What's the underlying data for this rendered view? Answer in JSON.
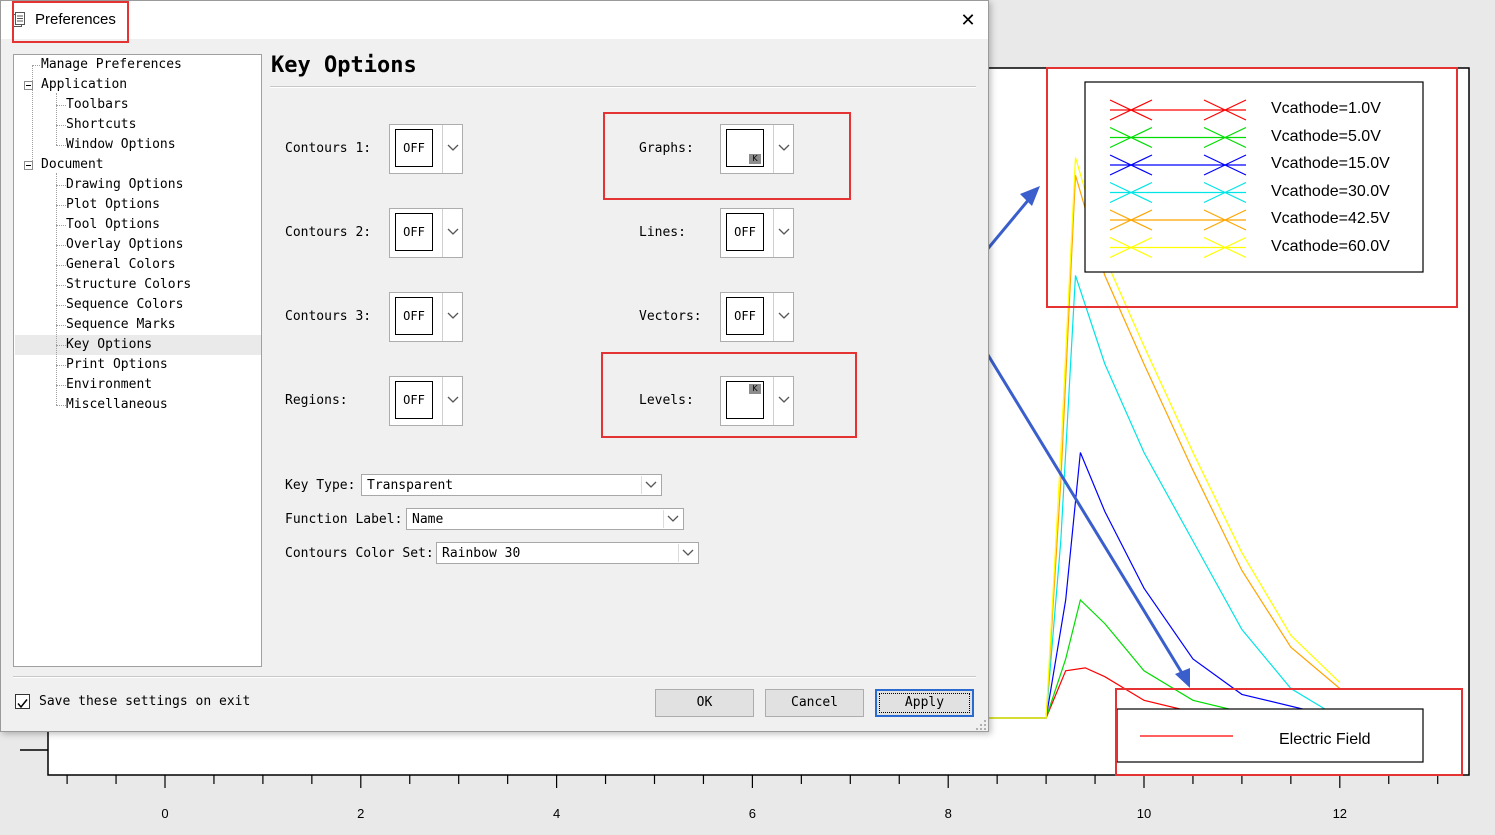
{
  "dialog": {
    "title": "Preferences",
    "close_glyph": "✕",
    "icon": "document-icon"
  },
  "tree": {
    "items": [
      {
        "label": "Manage Preferences"
      },
      {
        "label": "Application"
      },
      {
        "label": "Toolbars"
      },
      {
        "label": "Shortcuts"
      },
      {
        "label": "Window Options"
      },
      {
        "label": "Document"
      },
      {
        "label": "Drawing Options"
      },
      {
        "label": "Plot Options"
      },
      {
        "label": "Tool Options"
      },
      {
        "label": "Overlay Options"
      },
      {
        "label": "General Colors"
      },
      {
        "label": "Structure Colors"
      },
      {
        "label": "Sequence Colors"
      },
      {
        "label": "Sequence Marks"
      },
      {
        "label": "Key Options"
      },
      {
        "label": "Print Options"
      },
      {
        "label": "Environment"
      },
      {
        "label": "Miscellaneous"
      }
    ],
    "selected": "Key Options"
  },
  "section": {
    "title": "Key Options"
  },
  "keys": {
    "contours1": {
      "label": "Contours 1:",
      "value": "OFF"
    },
    "contours2": {
      "label": "Contours 2:",
      "value": "OFF"
    },
    "contours3": {
      "label": "Contours 3:",
      "value": "OFF"
    },
    "regions": {
      "label": "Regions:",
      "value": "OFF"
    },
    "graphs": {
      "label": "Graphs:",
      "value": "",
      "badge": "K",
      "badge_position": "bottom-right"
    },
    "lines": {
      "label": "Lines:",
      "value": "OFF"
    },
    "vectors": {
      "label": "Vectors:",
      "value": "OFF"
    },
    "levels": {
      "label": "Levels:",
      "value": "",
      "badge": "K",
      "badge_position": "top-right"
    }
  },
  "fields": {
    "key_type": {
      "label": "Key Type:",
      "value": "Transparent"
    },
    "function_label": {
      "label": "Function Label:",
      "value": "Name"
    },
    "contours_color_set": {
      "label": "Contours Color Set:",
      "value": "Rainbow 30"
    }
  },
  "footer": {
    "save_label": "Save these settings on exit",
    "save_checked": true,
    "ok": "OK",
    "cancel": "Cancel",
    "apply": "Apply"
  },
  "colors": {
    "highlight_box": "#e53333",
    "arrow": "#3a5fcd",
    "default_button_border": "#2a6bd1"
  },
  "chart_data": {
    "type": "line",
    "x_ticks": [
      "0",
      "2",
      "4",
      "6",
      "8",
      "10",
      "12"
    ],
    "xlim": [
      -2,
      13
    ],
    "series": [
      {
        "name": "Vcathode=1.0V",
        "color": "#ff0000",
        "x": [
          9.0,
          9.2,
          9.4,
          9.6,
          10.0,
          10.5,
          11,
          12
        ],
        "y": [
          0.0,
          0.08,
          0.085,
          0.07,
          0.03,
          0.01,
          0.0,
          0.0
        ]
      },
      {
        "name": "Vcathode=5.0V",
        "color": "#00dd00",
        "x": [
          9.0,
          9.2,
          9.35,
          9.6,
          10.0,
          10.5,
          11,
          12
        ],
        "y": [
          0.0,
          0.1,
          0.2,
          0.16,
          0.08,
          0.03,
          0.01,
          0.0
        ]
      },
      {
        "name": "Vcathode=15.0V",
        "color": "#0000ff",
        "x": [
          9.0,
          9.2,
          9.35,
          9.6,
          10.0,
          10.5,
          11,
          12
        ],
        "y": [
          0.0,
          0.2,
          0.45,
          0.35,
          0.22,
          0.1,
          0.04,
          0.0
        ]
      },
      {
        "name": "Vcathode=30.0V",
        "color": "#00e5e5",
        "x": [
          9.0,
          9.15,
          9.3,
          9.6,
          10.0,
          10.5,
          11,
          11.5,
          12
        ],
        "y": [
          0.0,
          0.3,
          0.75,
          0.6,
          0.45,
          0.3,
          0.15,
          0.05,
          0.0
        ]
      },
      {
        "name": "Vcathode=42.5V",
        "color": "#ffa500",
        "x": [
          9.0,
          9.15,
          9.3,
          9.6,
          10.0,
          10.5,
          11,
          11.5,
          12
        ],
        "y": [
          0.0,
          0.4,
          0.92,
          0.75,
          0.6,
          0.42,
          0.25,
          0.12,
          0.05
        ]
      },
      {
        "name": "Vcathode=60.0V",
        "color": "#ffff00",
        "x": [
          9.0,
          9.15,
          9.3,
          9.6,
          10.0,
          10.5,
          11,
          11.5,
          12
        ],
        "y": [
          0.0,
          0.45,
          0.95,
          0.78,
          0.63,
          0.45,
          0.28,
          0.14,
          0.06
        ]
      }
    ],
    "legend_top": [
      "Vcathode=1.0V",
      "Vcathode=5.0V",
      "Vcathode=15.0V",
      "Vcathode=30.0V",
      "Vcathode=42.5V",
      "Vcathode=60.0V"
    ],
    "legend_bottom": "Electric Field"
  }
}
